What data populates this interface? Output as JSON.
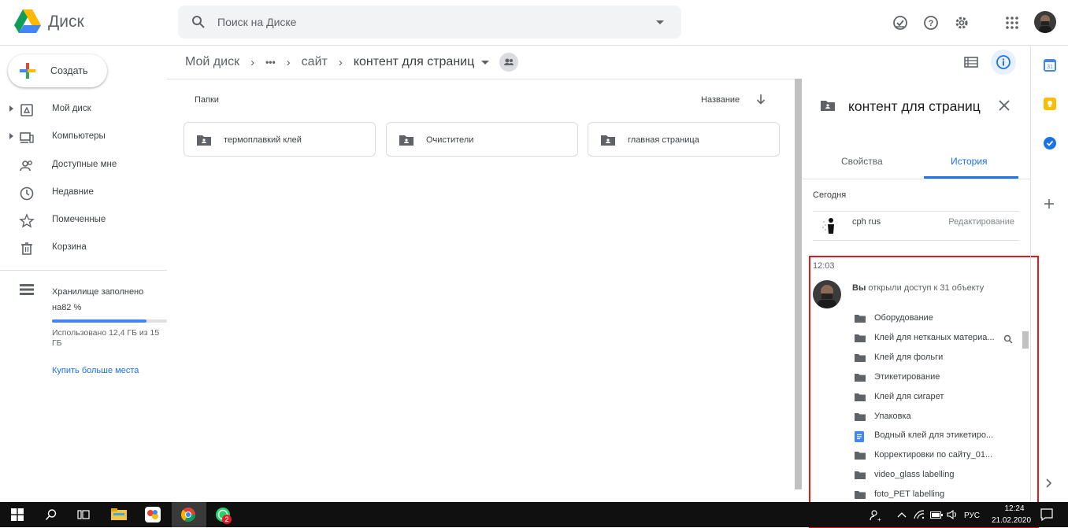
{
  "header": {
    "app_name": "Диск",
    "search": {
      "placeholder": "Поиск на Диске"
    }
  },
  "sidebar": {
    "create_label": "Создать",
    "items": [
      {
        "label": "Мой диск",
        "icon": "drive-icon",
        "expandable": true
      },
      {
        "label": "Компьютеры",
        "icon": "computer-icon",
        "expandable": true
      },
      {
        "label": "Доступные мне",
        "icon": "shared-people-icon",
        "expandable": false
      },
      {
        "label": "Недавние",
        "icon": "clock-icon",
        "expandable": false
      },
      {
        "label": "Помеченные",
        "icon": "star-icon",
        "expandable": false
      },
      {
        "label": "Корзина",
        "icon": "trash-icon",
        "expandable": false
      }
    ],
    "storage": {
      "label": "Хранилище заполнено на82 %",
      "percent": 82,
      "used_text": "Использовано 12,4 ГБ из 15 ГБ",
      "buy_more": "Купить больше места"
    }
  },
  "breadcrumb": {
    "root": "Мой диск",
    "ellipsis": "•••",
    "middle": "сайт",
    "current": "контент для страниц"
  },
  "main": {
    "folders_heading": "Папки",
    "sort_label": "Название",
    "folders": [
      {
        "name": "термоплавкий клей"
      },
      {
        "name": "Очистители"
      },
      {
        "name": "главная страница"
      }
    ]
  },
  "details": {
    "title": "контент для страниц",
    "tabs": {
      "properties": "Свойства",
      "history": "История"
    },
    "active_tab": "История",
    "today_label": "Сегодня",
    "entry": {
      "user": "cph rus",
      "action": "Редактирование"
    },
    "time": "12:03",
    "you_bold": "Вы",
    "you_rest": " открыли доступ к 31 объекту",
    "items": [
      {
        "name": "Оборудование",
        "type": "folder"
      },
      {
        "name": "Клей для нетканых материа...",
        "type": "folder"
      },
      {
        "name": "Клей для фольги",
        "type": "folder"
      },
      {
        "name": "Этикетирование",
        "type": "folder"
      },
      {
        "name": "Клей для сигарет",
        "type": "folder"
      },
      {
        "name": "Упаковка",
        "type": "folder"
      },
      {
        "name": "Водный клей для этикетиро...",
        "type": "doc"
      },
      {
        "name": "Корректировки по сайту_01...",
        "type": "folder"
      },
      {
        "name": "video_glass labelling",
        "type": "folder"
      },
      {
        "name": "foto_PET labelling",
        "type": "folder"
      }
    ]
  },
  "taskbar": {
    "lang": "РУС",
    "time": "12:24",
    "date": "21.02.2020",
    "badge_count": "2"
  },
  "colors": {
    "accent": "#1a73e8",
    "highlight": "#e1191b",
    "folder_gray": "#5f6368"
  }
}
